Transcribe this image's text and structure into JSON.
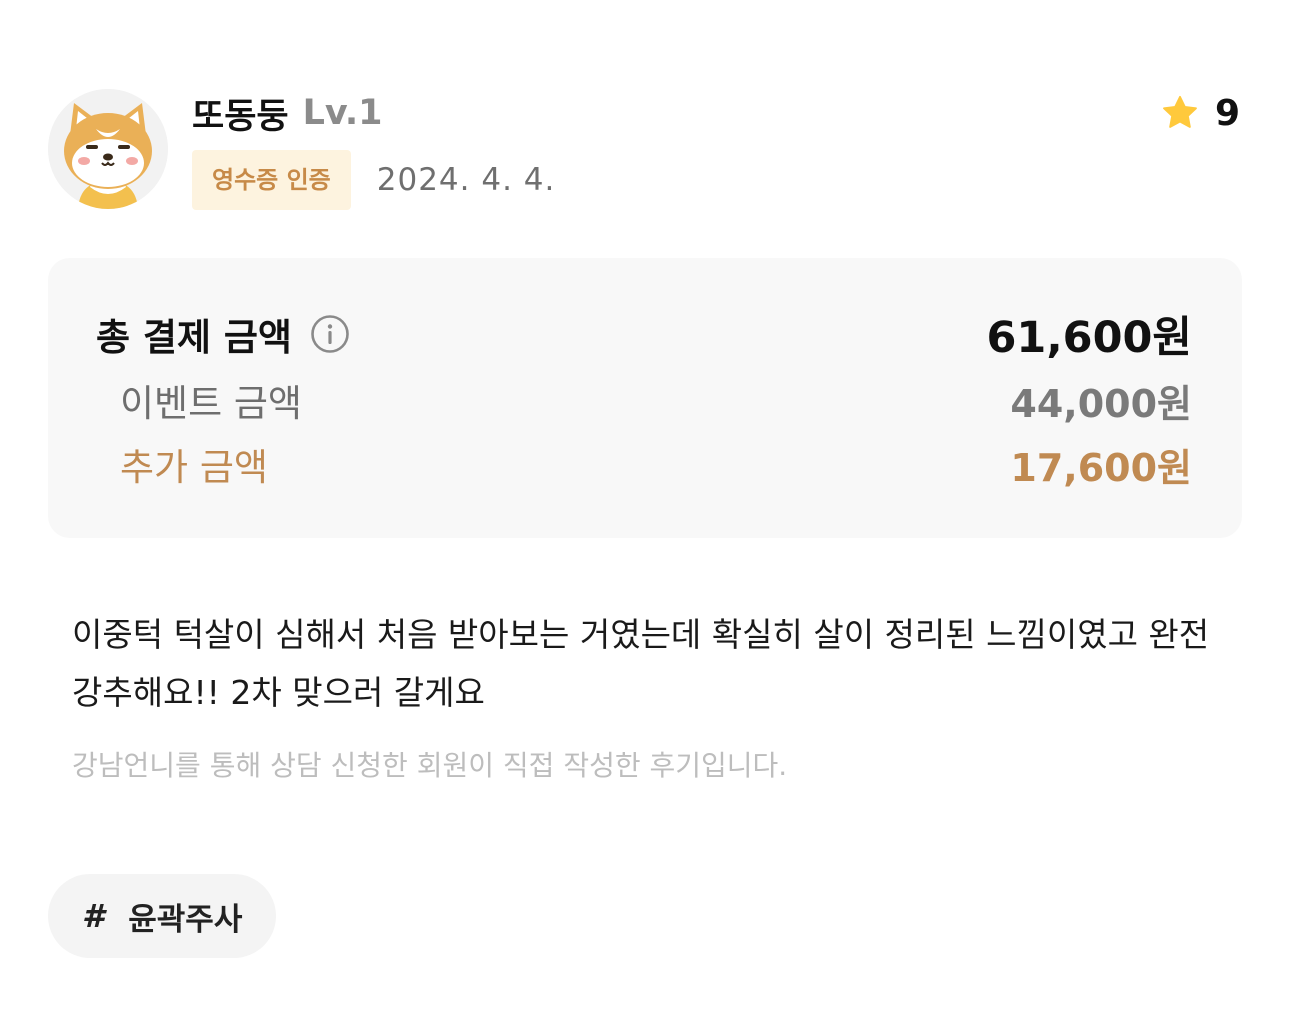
{
  "user": {
    "avatar_icon": "shiba-dog-avatar-icon",
    "nickname": "또동둥",
    "level": "Lv.1",
    "badge": "영수증 인증",
    "date": "2024. 4. 4.",
    "rating_icon": "star-icon",
    "rating": "9"
  },
  "price": {
    "total_label": "총 결제 금액",
    "info_icon": "info-icon",
    "total_value": "61,600원",
    "event_label": "이벤트 금액",
    "event_value": "44,000원",
    "extra_label": "추가 금액",
    "extra_value": "17,600원"
  },
  "review": {
    "text": "이중턱 턱살이 심해서 처음 받아보는 거였는데 확실히 살이 정리된 느낌이였고 완전 강추해요!! 2차 맞으러 갈게요",
    "disclaimer": "강남언니를 통해 상담 신청한 회원이 직접 작성한 후기입니다."
  },
  "tag": {
    "hash": "#",
    "label": "윤곽주사"
  },
  "colors": {
    "accent": "#c08a52",
    "badge_bg": "#fdf3df",
    "star": "#ffc93c"
  }
}
